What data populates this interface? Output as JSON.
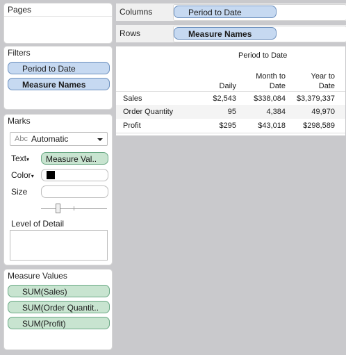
{
  "pages": {
    "title": "Pages"
  },
  "filters": {
    "title": "Filters",
    "items": [
      "Period to Date",
      "Measure Names"
    ]
  },
  "marks": {
    "title": "Marks",
    "mark_type_abbr": "Abc",
    "mark_type": "Automatic",
    "text_label": "Text",
    "text_pill": "Measure Val..",
    "color_label": "Color",
    "color_swatch": "#000000",
    "size_label": "Size",
    "level_of_detail": "Level of Detail"
  },
  "measure_values": {
    "title": "Measure Values",
    "items": [
      "SUM(Sales)",
      "SUM(Order Quantit..",
      "SUM(Profit)"
    ]
  },
  "shelves": {
    "columns_label": "Columns",
    "columns_pill": "Period to Date",
    "rows_label": "Rows",
    "rows_pill": "Measure Names"
  },
  "crosstab": {
    "header": "Period to Date",
    "columns": [
      [
        "",
        "Daily"
      ],
      [
        "Month to",
        "Date"
      ],
      [
        "Year to",
        "Date"
      ]
    ],
    "rows": [
      {
        "label": "Sales",
        "values": [
          "$2,543",
          "$338,084",
          "$3,379,337"
        ]
      },
      {
        "label": "Order Quantity",
        "values": [
          "95",
          "4,384",
          "49,970"
        ]
      },
      {
        "label": "Profit",
        "values": [
          "$295",
          "$43,018",
          "$298,589"
        ]
      }
    ]
  }
}
